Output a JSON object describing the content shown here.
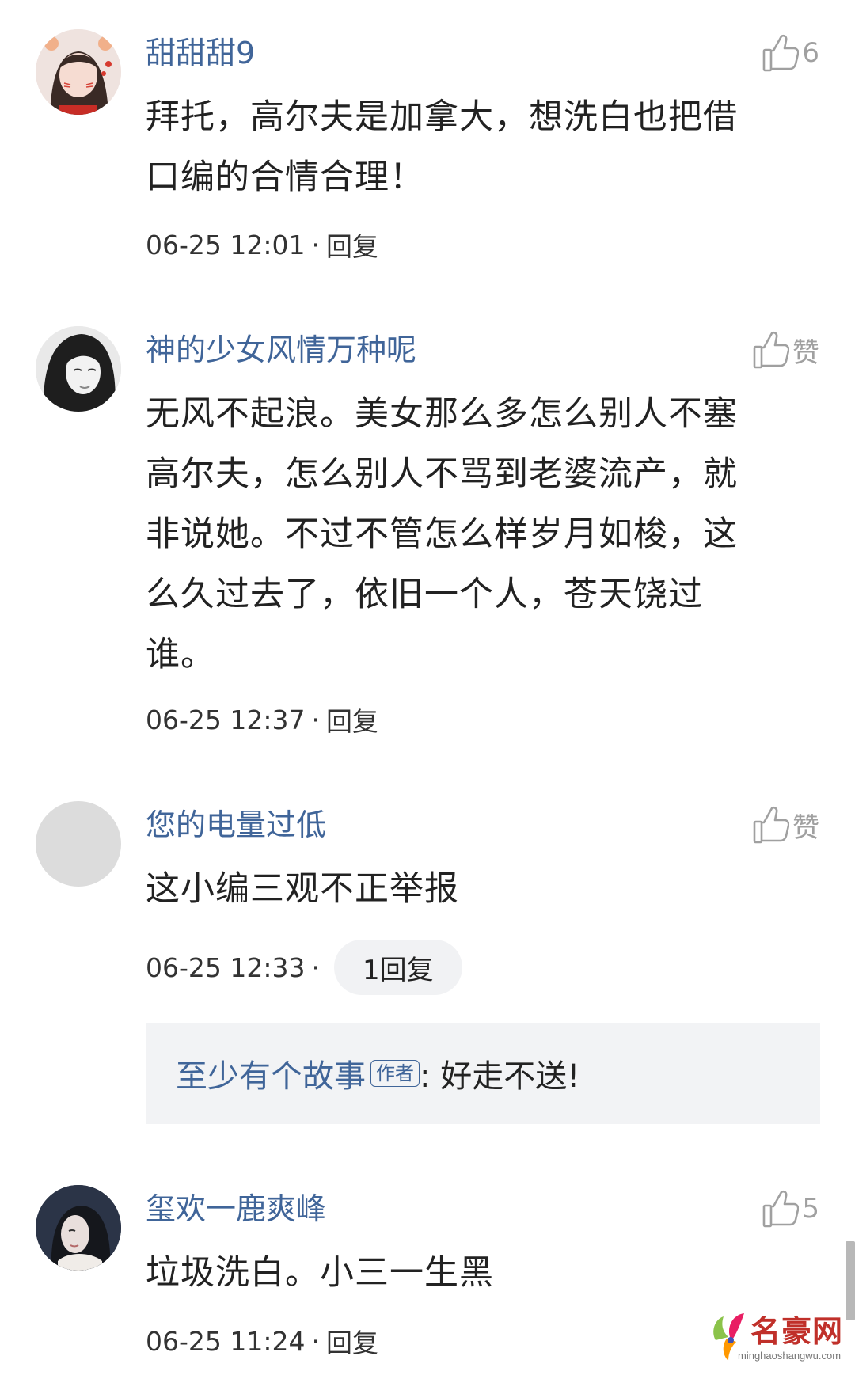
{
  "comments": [
    {
      "username": "甜甜甜9",
      "likes": "6",
      "text_lines": [
        "拜托，高尔夫是加拿大，想洗白也把借",
        "口编的合情合理！"
      ],
      "time": "06-25 12:01",
      "separator": "·",
      "reply_label": "回复"
    },
    {
      "username": "神的少女风情万种呢",
      "likes": "赞",
      "text_lines": [
        "无风不起浪。美女那么多怎么别人不塞",
        "高尔夫，怎么别人不骂到老婆流产，就",
        "非说她。不过不管怎么样岁月如梭，这",
        "么久过去了，依旧一个人，苍天饶过",
        "谁。"
      ],
      "time": "06-25 12:37",
      "separator": "·",
      "reply_label": "回复"
    },
    {
      "username": "您的电量过低",
      "likes": "赞",
      "text_lines": [
        "这小编三观不正举报"
      ],
      "time": "06-25 12:33",
      "separator": "·",
      "reply_label": "1回复",
      "sub_reply": {
        "username": "至少有个故事",
        "badge": "作者",
        "text": ": 好走不送!"
      }
    },
    {
      "username": "玺欢一鹿爽峰",
      "likes": "5",
      "text_lines": [
        "垃圾洗白。小三一生黑"
      ],
      "time": "06-25 11:24",
      "separator": "·",
      "reply_label": "回复"
    }
  ],
  "watermark": {
    "name": "名豪网",
    "domain": "minghaoshangwu.com"
  },
  "colors": {
    "username": "#406599",
    "body": "#222222",
    "meta": "#333333",
    "like": "#a0a0a0",
    "subreply_bg": "#f2f3f5"
  }
}
